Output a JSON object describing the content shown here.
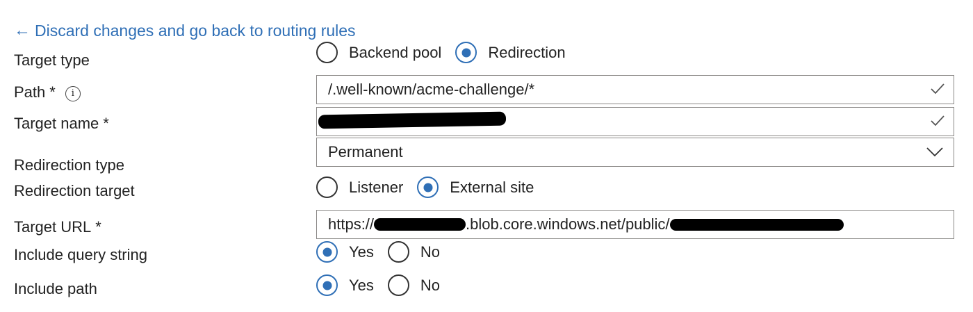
{
  "back_link": {
    "arrow": "←",
    "text": "Discard changes and go back to routing rules"
  },
  "accent_color": "#2f6fb6",
  "fields": {
    "target_type": {
      "label": "Target type",
      "options": [
        {
          "label": "Backend pool",
          "selected": false
        },
        {
          "label": "Redirection",
          "selected": true
        }
      ]
    },
    "path": {
      "label": "Path",
      "required_mark": "*",
      "info_icon": "ⓘ",
      "value": "/.well-known/acme-challenge/*",
      "icon": "checkmark-icon"
    },
    "target_name": {
      "label": "Target name",
      "required_mark": "*",
      "value": "",
      "redacted": true,
      "icon": "checkmark-icon"
    },
    "redirection_type": {
      "label": "Redirection type",
      "value": "Permanent",
      "icon": "chevron-down-icon"
    },
    "redirection_target": {
      "label": "Redirection target",
      "options": [
        {
          "label": "Listener",
          "selected": false
        },
        {
          "label": "External site",
          "selected": true
        }
      ]
    },
    "target_url": {
      "label": "Target URL",
      "required_mark": "*",
      "value_prefix": "https://",
      "value_middle": ".blob.core.windows.net/public/",
      "redacted": true
    },
    "include_query_string": {
      "label": "Include query string",
      "options": [
        {
          "label": "Yes",
          "selected": true
        },
        {
          "label": "No",
          "selected": false
        }
      ]
    },
    "include_path": {
      "label": "Include path",
      "options": [
        {
          "label": "Yes",
          "selected": true
        },
        {
          "label": "No",
          "selected": false
        }
      ]
    }
  }
}
